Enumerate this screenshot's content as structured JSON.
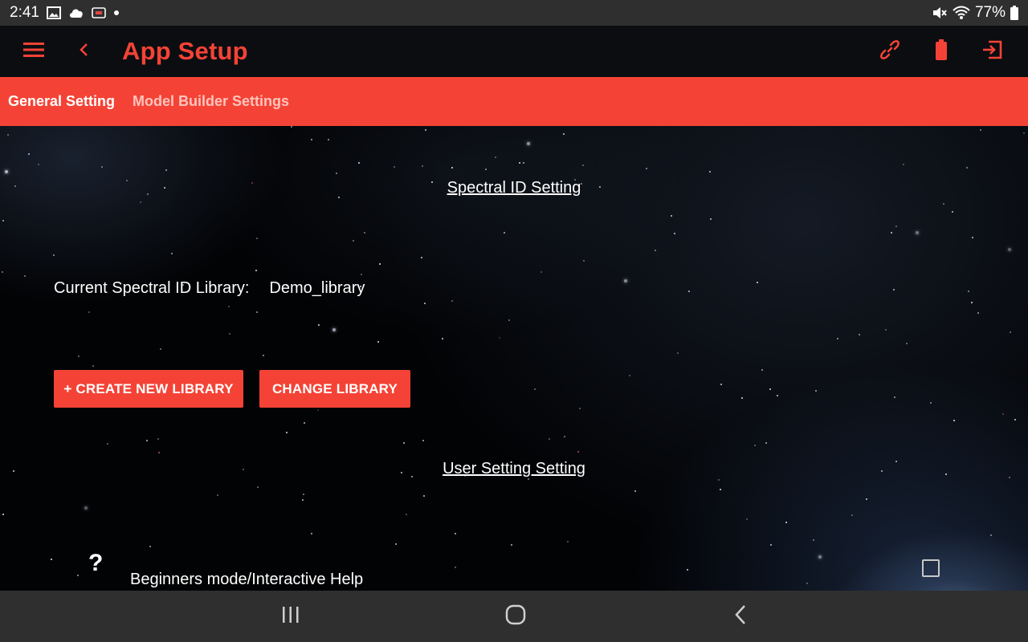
{
  "status_bar": {
    "time": "2:41",
    "battery_text": "77%"
  },
  "app_bar": {
    "title": "App Setup"
  },
  "tabs": [
    {
      "label": "General Setting",
      "active": true
    },
    {
      "label": "Model Builder Settings",
      "active": false
    }
  ],
  "spectral_section": {
    "heading": "Spectral ID Setting",
    "library_label": "Current Spectral ID Library:",
    "library_value": "Demo_library",
    "create_button": "+ CREATE NEW LIBRARY",
    "change_button": "CHANGE LIBRARY"
  },
  "user_section": {
    "heading": "User Setting Setting",
    "help_icon_text": "?",
    "help_label": "Beginners mode/Interactive Help",
    "help_checked": false
  },
  "colors": {
    "accent": "#f44336",
    "tab_inactive": "#ffc4bd",
    "system_bar": "#2f2f2f"
  },
  "icons": [
    "menu-icon",
    "back-arrow-icon",
    "link-icon",
    "battery-icon",
    "logout-icon",
    "gallery-icon",
    "cloud-icon",
    "notification-icon",
    "mute-icon",
    "wifi-icon",
    "recents-icon",
    "home-icon",
    "nav-back-icon"
  ]
}
